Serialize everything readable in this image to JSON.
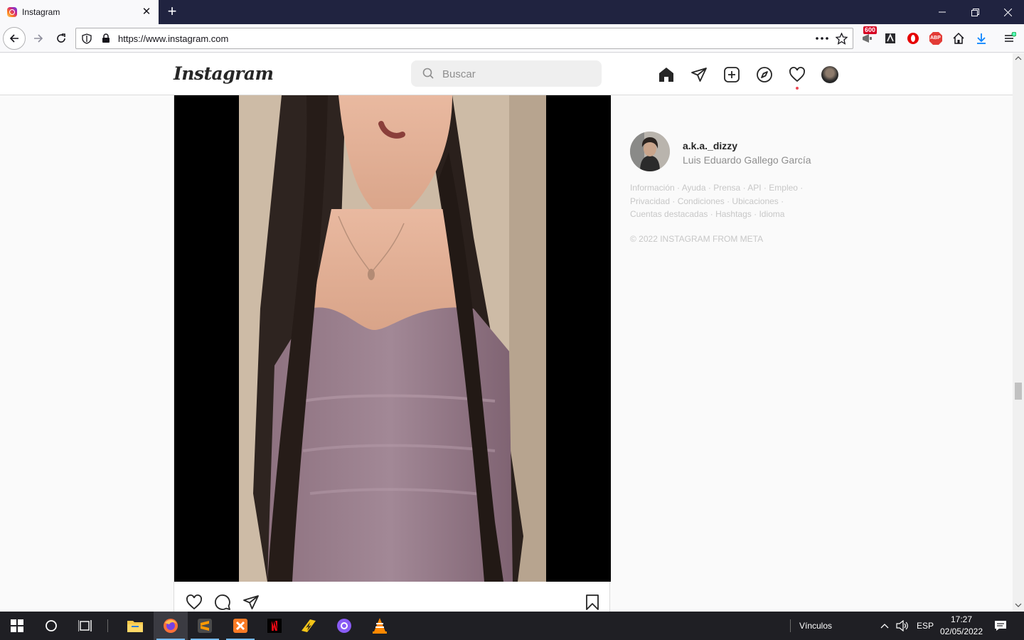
{
  "browser": {
    "tab_title": "Instagram",
    "url": "https://www.instagram.com",
    "badge_count": "600",
    "abp_label": "ABP"
  },
  "instagram": {
    "logo": "Instagram",
    "search_placeholder": "Buscar"
  },
  "sidebar": {
    "username": "a.k.a._dizzy",
    "full_name": "Luis Eduardo Gallego García",
    "footer_links": [
      "Información",
      "Ayuda",
      "Prensa",
      "API",
      "Empleo",
      "Privacidad",
      "Condiciones",
      "Ubicaciones",
      "Cuentas destacadas",
      "Hashtags",
      "Idioma"
    ],
    "copyright": "© 2022 INSTAGRAM FROM META"
  },
  "taskbar": {
    "links_label": "Vínculos",
    "language": "ESP",
    "time": "17:27",
    "date": "02/05/2022"
  },
  "colors": {
    "chrome_dark": "#202340",
    "ig_text": "#262626",
    "ig_secondary": "#8e8e8e",
    "notification": "#ed4956"
  }
}
